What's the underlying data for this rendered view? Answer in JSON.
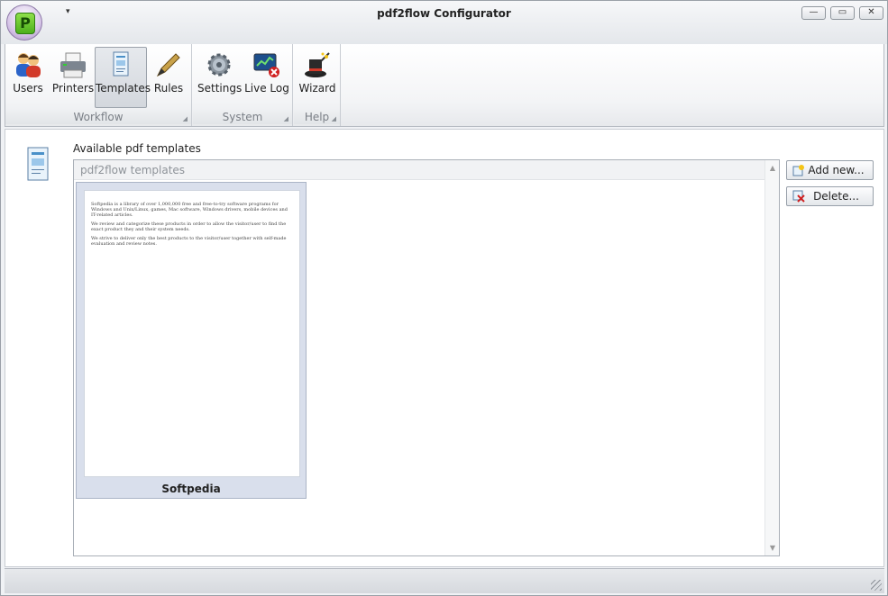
{
  "window": {
    "title": "pdf2flow Configurator"
  },
  "titlebar": {
    "qat_arrow": "▾",
    "minimize": "—",
    "maximize": "▭",
    "close": "✕",
    "logo_letter": "P"
  },
  "ribbon": {
    "groups": [
      {
        "label": "Workflow",
        "buttons": [
          "Users",
          "Printers",
          "Templates",
          "Rules"
        ]
      },
      {
        "label": "System",
        "buttons": [
          "Settings",
          "Live Log"
        ]
      },
      {
        "label": "Help",
        "buttons": [
          "Wizard"
        ]
      }
    ],
    "active": "Templates"
  },
  "content": {
    "available_label": "Available pdf templates",
    "list_header": "pdf2flow templates",
    "templates": [
      {
        "name": "Softpedia",
        "preview_paragraphs": [
          "Softpedia is a library of over 1,000,000 free and free-to-try software programs for Windows and Unix/Linux, games, Mac software, Windows drivers, mobile devices and IT-related articles.",
          "We review and categorize these products in order to allow the visitor/user to find the exact product they and their system needs.",
          "We strive to deliver only the best products to the visitor/user together with self-made evaluation and review notes."
        ]
      }
    ],
    "add_button": "Add new...",
    "delete_button": "Delete..."
  },
  "colors": {
    "accent_green": "#4caf1c",
    "delete_red": "#d02020"
  }
}
